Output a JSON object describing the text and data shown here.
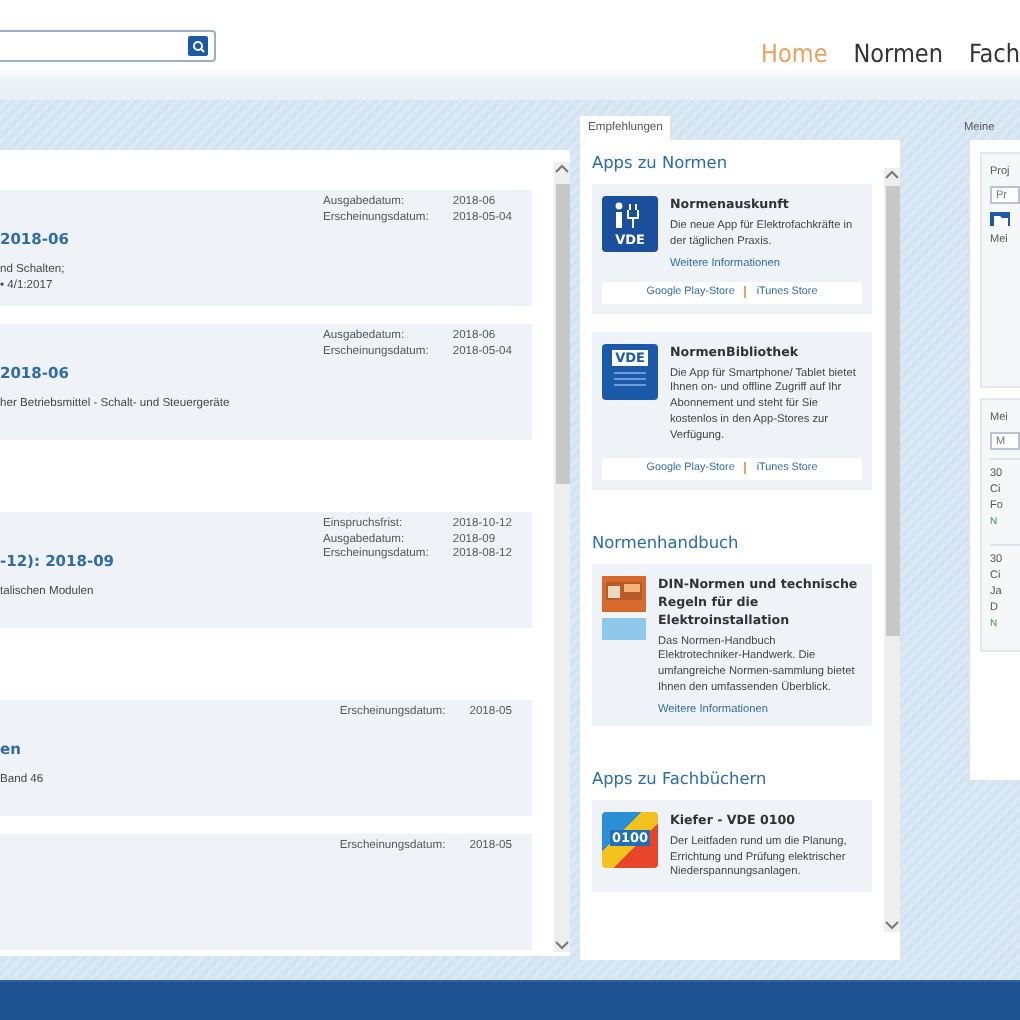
{
  "header": {
    "nav": [
      {
        "label": "Home",
        "selected": true
      },
      {
        "label": "Normen",
        "selected": false
      },
      {
        "label": "Fach",
        "selected": false
      }
    ]
  },
  "results": {
    "groups": [
      {
        "items": [
          {
            "title": "2018-06",
            "lines": [
              "nd Schalten;",
              "• 4/1:2017"
            ],
            "meta": [
              {
                "label": "Ausgabedatum:",
                "value": "2018-06"
              },
              {
                "label": "Erscheinungsdatum:",
                "value": "2018-05-04"
              }
            ]
          },
          {
            "title": "2018-06",
            "lines": [
              "her Betriebsmittel - Schalt- und Steuergeräte"
            ],
            "meta": [
              {
                "label": "Ausgabedatum:",
                "value": "2018-06"
              },
              {
                "label": "Erscheinungsdatum:",
                "value": "2018-05-04"
              }
            ]
          }
        ]
      },
      {
        "items": [
          {
            "title": "-12): 2018-09",
            "lines": [
              "talischen Modulen"
            ],
            "meta": [
              {
                "label": "Einspruchsfrist:",
                "value": "2018-10-12"
              },
              {
                "label": "Ausgabedatum:",
                "value": "2018-09"
              },
              {
                "label": "Erscheinungsdatum:",
                "value": "2018-08-12"
              }
            ]
          }
        ]
      },
      {
        "items": [
          {
            "title": "en",
            "lines": [
              "Band 46"
            ],
            "meta": [
              {
                "label": "Erscheinungsdatum:",
                "value": "2018-05"
              }
            ]
          },
          {
            "meta": [
              {
                "label": "Erscheinungsdatum:",
                "value": "2018-05"
              }
            ]
          }
        ]
      }
    ]
  },
  "recommendations": {
    "tab": "Empfehlungen",
    "sections": [
      {
        "heading": "Apps zu Normen",
        "items": [
          {
            "kind": "plugapp",
            "icon_label": "VDE",
            "title": "Normenauskunft",
            "text": "Die neue App für Elektrofachkräfte in der täglichen Praxis.",
            "link": "Weitere Informationen",
            "stores": [
              "Google Play-Store",
              "iTunes Store"
            ]
          },
          {
            "kind": "libapp",
            "icon_label": "VDE",
            "title": "NormenBibliothek",
            "text": "Die App für Smartphone/ Tablet bietet Ihnen on- und offline Zugriff auf Ihr Abonnement und steht für Sie kostenlos in den App-Stores zur Verfügung.",
            "stores": [
              "Google Play-Store",
              "iTunes Store"
            ]
          }
        ]
      },
      {
        "heading": "Normenhandbuch",
        "items": [
          {
            "kind": "book",
            "title": "DIN-Normen und technische Regeln für die Elektroinstallation",
            "text": "Das Normen-Handbuch Elektrotechniker-Handwerk. Die umfangreiche Normen-sammlung bietet Ihnen den umfassenden Überblick.",
            "link": "Weitere Informationen"
          }
        ]
      },
      {
        "heading": "Apps zu Fachbüchern",
        "items": [
          {
            "kind": "tileapp",
            "icon_label": "0100",
            "title": "Kiefer - VDE 0100",
            "text": "Der Leitfaden rund um die Planung, Errichtung und Prüfung elektrischer Niederspannungsanlagen."
          }
        ]
      }
    ]
  },
  "side": {
    "tab": "Meine",
    "project_label": "Proj",
    "project_field": {
      "placeholder": "Pr"
    },
    "section_1": "Mei",
    "section_2": "Mei",
    "search_field": {
      "placeholder": "M"
    },
    "entries": [
      {
        "lines": [
          "30",
          "Ci"
        ],
        "sub": "Fo",
        "status": "N"
      },
      {
        "lines": [
          "30",
          "Ci",
          "Ja"
        ],
        "sub": "D",
        "status": "N"
      }
    ]
  }
}
